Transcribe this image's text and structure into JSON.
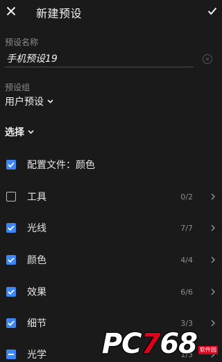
{
  "header": {
    "title": "新建预设",
    "close_icon": "close-icon",
    "confirm_icon": "checkmark-icon"
  },
  "preset_name": {
    "label": "预设名称",
    "value": "手机预设19"
  },
  "preset_group": {
    "label": "预设组",
    "value": "用户预设"
  },
  "select": {
    "label": "选择"
  },
  "items": [
    {
      "label": "配置文件：颜色",
      "state": "checked",
      "count": "",
      "has_arrow": false
    },
    {
      "label": "工具",
      "state": "unchecked",
      "count": "0/2",
      "has_arrow": true
    },
    {
      "label": "光线",
      "state": "checked",
      "count": "7/7",
      "has_arrow": true
    },
    {
      "label": "颜色",
      "state": "checked",
      "count": "4/4",
      "has_arrow": true
    },
    {
      "label": "效果",
      "state": "checked",
      "count": "6/6",
      "has_arrow": true
    },
    {
      "label": "细节",
      "state": "checked",
      "count": "3/3",
      "has_arrow": true
    },
    {
      "label": "光学",
      "state": "partial",
      "count": "1/3",
      "has_arrow": true
    }
  ],
  "watermark": {
    "text_a": "PC",
    "text_b": "7",
    "text_c": "68",
    "badge": "软件园"
  },
  "colors": {
    "background": "#1a1a1a",
    "accent": "#3d86f5",
    "muted": "#8c8c8c"
  }
}
